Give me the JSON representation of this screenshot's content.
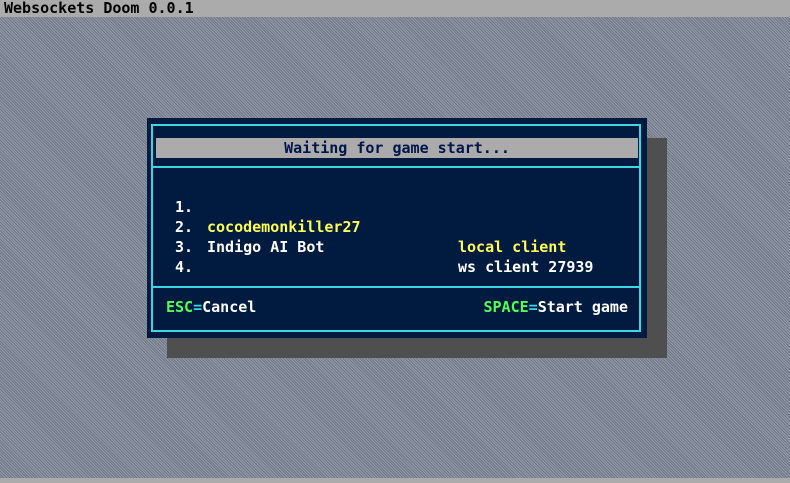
{
  "app": {
    "title": "Websockets Doom 0.0.1"
  },
  "dialog": {
    "heading": "Waiting for game start...",
    "players": [
      {
        "number": "1.",
        "name": "cocodemonkiller27",
        "client": "local client",
        "is_local": true
      },
      {
        "number": "2.",
        "name": "Indigo AI Bot",
        "client": "ws client 27939",
        "is_local": false
      },
      {
        "number": "3.",
        "name": "",
        "client": "",
        "is_local": false
      },
      {
        "number": "4.",
        "name": "",
        "client": "",
        "is_local": false
      }
    ],
    "footer": {
      "cancel_key": "ESC",
      "cancel_sep": "=",
      "cancel_label": "Cancel",
      "start_key": "SPACE",
      "start_sep": "=",
      "start_label": "Start game"
    }
  },
  "colors": {
    "dialog_bg": "#001a40",
    "border": "#3ad7e5",
    "highlight": "#ffff55",
    "key": "#55ff55",
    "text": "#ffffff"
  }
}
